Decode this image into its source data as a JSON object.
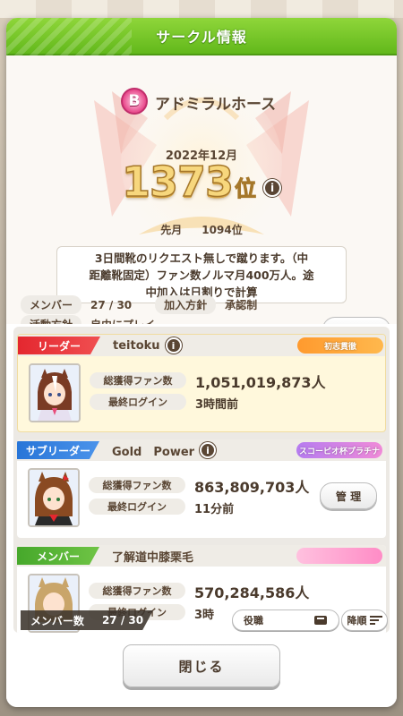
{
  "dialog": {
    "title": "サークル情報",
    "accent_color": "#6ec626"
  },
  "circle": {
    "rank_badge": "B",
    "name": "アドミラルホース",
    "period": "2022年12月",
    "rank_number": "1373",
    "rank_suffix": "位",
    "info_glyph": "i",
    "prev_label": "先月",
    "prev_value": "1094位",
    "description_lines": [
      "3日間靴のリクエスト無しで蹴ります。（中",
      "距離靴固定）ファン数ノルマ月400万人。途",
      "中加入は日割りで計算"
    ]
  },
  "meta": {
    "members_label": "メンバー",
    "members_value": "27 / 30",
    "join_label": "加入方針",
    "join_value": "承認制",
    "policy_label": "活動方針",
    "policy_value": "自由にプレイ",
    "edit_button": "編 集"
  },
  "stats_labels": {
    "fans": "総獲得ファン数",
    "last_login": "最終ログイン"
  },
  "members": [
    {
      "role": "リーダー",
      "name": "teitoku",
      "title_badge": "初志貫徹",
      "fans": "1,051,019,873人",
      "last_login": "3時間前",
      "role_color": "#e4272f"
    },
    {
      "role": "サブリーダー",
      "name": "Gold　Power",
      "title_badge": "スコーピオ杯プラチナ",
      "fans": "863,809,703人",
      "last_login": "11分前",
      "role_color": "#2775d8",
      "action_button": "管 理"
    },
    {
      "role": "メンバー",
      "name": "了解道中膝栗毛",
      "title_badge": "",
      "fans": "570,284,586人",
      "last_login": "3時",
      "role_color": "#46a82b"
    }
  ],
  "list_footer": {
    "count_label": "メンバー数",
    "count_value": "27 / 30",
    "sort_role": "役職",
    "sort_order": "降順"
  },
  "footer": {
    "close_button": "閉じる"
  }
}
